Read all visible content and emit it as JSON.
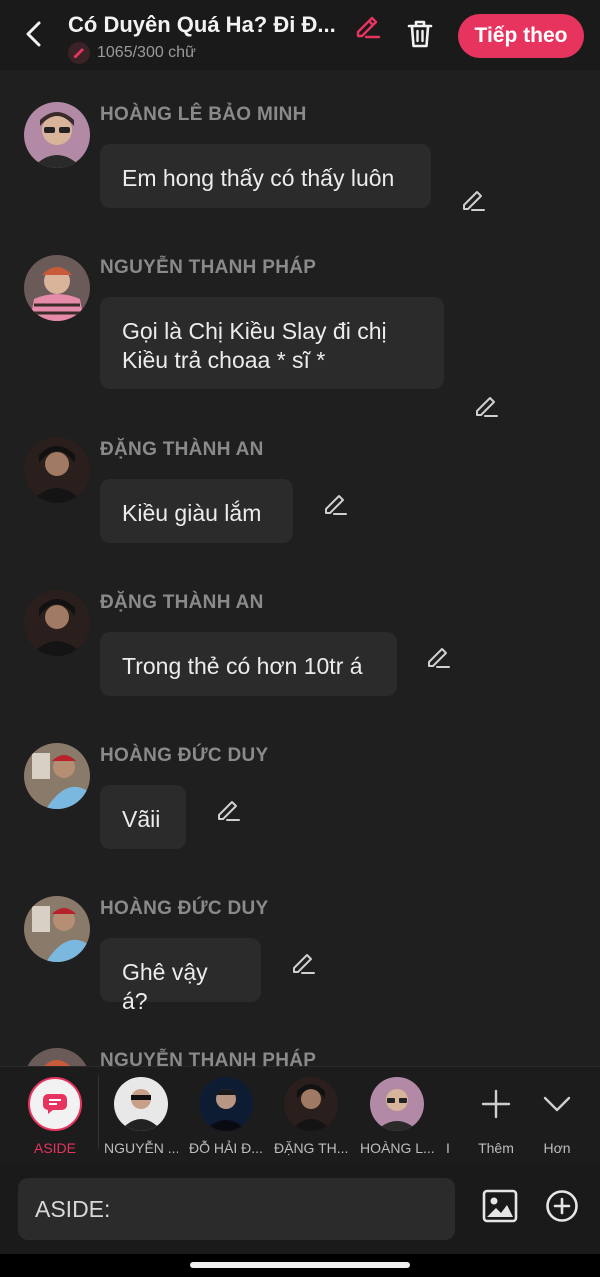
{
  "header": {
    "title": "Có Duyên Quá Ha? Đi Đ...",
    "word_count": "1065/300 chữ",
    "next_label": "Tiếp theo",
    "accent": "#e6345f"
  },
  "messages": [
    {
      "sender": "HOÀNG LÊ BẢO MINH",
      "text": "Em hong thấy có thấy luôn"
    },
    {
      "sender": "NGUYỄN THANH PHÁP",
      "text": "Gọi là Chị Kiều Slay đi chị Kiều trả choaa * sĩ *"
    },
    {
      "sender": "ĐẶNG THÀNH AN",
      "text": "Kiều giàu lắm"
    },
    {
      "sender": "ĐẶNG THÀNH AN",
      "text": "Trong thẻ có hơn 10tr á"
    },
    {
      "sender": "HOÀNG ĐỨC DUY",
      "text": "Vãii"
    },
    {
      "sender": "HOÀNG ĐỨC DUY",
      "text": "Ghê vậy á?"
    },
    {
      "sender": "NGUYỄN THANH PHÁP",
      "text": ""
    }
  ],
  "characters": [
    {
      "name": "ASIDE"
    },
    {
      "name": "NGUYỄN ..."
    },
    {
      "name": "ĐỖ HẢI Đ..."
    },
    {
      "name": "ĐẶNG TH..."
    },
    {
      "name": "HOÀNG L..."
    },
    {
      "name": "I"
    }
  ],
  "more": {
    "add_label": "Thêm",
    "more_label": "Hơn"
  },
  "input": {
    "value": "ASIDE:"
  },
  "icons": [
    "back-arrow-icon",
    "pencil-icon",
    "trash-icon",
    "chat-bubble-icon",
    "plus-icon",
    "chevron-down-icon",
    "image-icon",
    "add-circle-icon"
  ]
}
